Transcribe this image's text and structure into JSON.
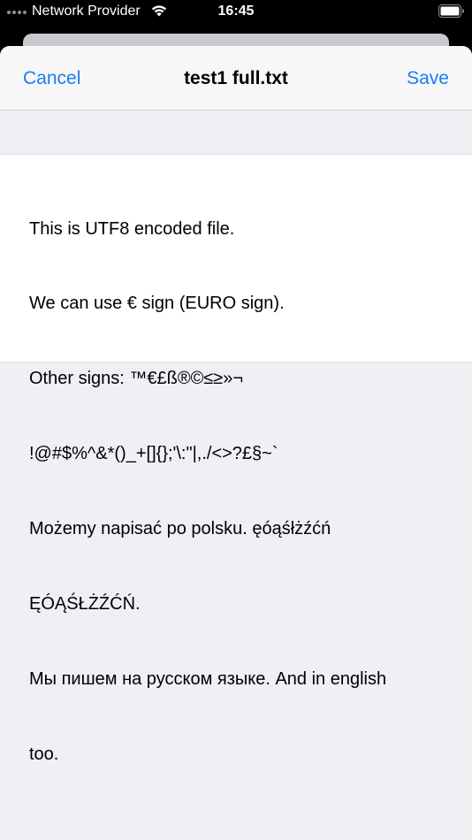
{
  "status_bar": {
    "carrier": "Network Provider",
    "time": "16:45",
    "signal_icon": "signal-dots-icon",
    "wifi_icon": "wifi-icon",
    "battery_icon": "battery-icon"
  },
  "nav": {
    "cancel_label": "Cancel",
    "title": "test1 full.txt",
    "save_label": "Save",
    "accent_color": "#1a7cf6"
  },
  "editor": {
    "lines": [
      "This is UTF8 encoded file.",
      "We can use € sign (EURO sign).",
      "Other signs: ™€£ß®©≤≥»¬",
      "!@#$%^&*()_+[]{};'\\:\"|,./<>?£§~`",
      "Możemy napisać po polsku. ęóąśłżźćń",
      "ĘÓĄŚŁŻŹĆŃ.",
      "Мы пишем на русском языке. And in english",
      "too."
    ]
  }
}
